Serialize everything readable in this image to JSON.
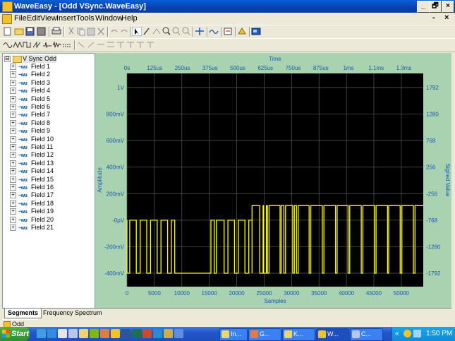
{
  "window": {
    "title": "WaveEasy - [Odd VSync.WaveEasy]",
    "min": "_",
    "max": "🗗",
    "close": "×"
  },
  "menu": {
    "items": [
      "File",
      "Edit",
      "View",
      "Insert",
      "Tools",
      "Window",
      "Help"
    ],
    "mdi_min": "-",
    "mdi_close": "×"
  },
  "tree": {
    "root": "V Sync Odd",
    "expander": "⊟",
    "sig_icon_text": "~wu",
    "items": [
      "Field 1",
      "Field 2",
      "Field 3",
      "Field 4",
      "Field 5",
      "Field 6",
      "Field 7",
      "Field 8",
      "Field 9",
      "Field 10",
      "Field 11",
      "Field 12",
      "Field 13",
      "Field 14",
      "Field 15",
      "Field 16",
      "Field 17",
      "Field 18",
      "Field 19",
      "Field 20",
      "Field 21"
    ]
  },
  "tabs": {
    "segments": "Segments",
    "frequency": "Frequency Spectrum"
  },
  "minidoc": "Odd VSy",
  "taskbar": {
    "start": "Start",
    "tasks": [
      "In...",
      "G...",
      "K...",
      "W...",
      "C..."
    ],
    "tray_arrow": "«",
    "clock": "1:50 PM"
  },
  "colors": {
    "plot_bg": "#000000",
    "panel_bg": "#a9d3b0",
    "trace": "#ffff00",
    "label": "#1a56b0"
  },
  "chart_data": {
    "type": "line",
    "top_axis_title": "Time",
    "top_ticks": [
      "0s",
      "125us",
      "250us",
      "375us",
      "500us",
      "625us",
      "750us",
      "875us",
      "1ms",
      "1.1ms",
      "1.3ms"
    ],
    "xlabel": "Samples",
    "x_ticks": [
      "0",
      "5000",
      "10000",
      "15000",
      "20000",
      "25000",
      "30000",
      "35000",
      "40000",
      "45000",
      "50000"
    ],
    "xlim": [
      0,
      54000
    ],
    "ylabel": "Amplitude",
    "y_ticks": [
      "1V",
      "800mV",
      "600mV",
      "400mV",
      "200mV",
      "-0pV",
      "-200mV",
      "-400mV"
    ],
    "ylim": [
      -400,
      1100
    ],
    "y2label": "Signed Value",
    "y2_ticks": [
      "1792",
      "1280",
      "768",
      "256",
      "-256",
      "-768",
      "-1280",
      "-1792"
    ],
    "series": [
      {
        "values_note": "",
        "segments": [
          {
            "x0": 0,
            "x1": 22800,
            "low": -400,
            "high": 0,
            "pulses": [
              [
                0,
                500
              ],
              [
                1700,
                2400
              ],
              [
                3600,
                4300
              ],
              [
                5500,
                6200
              ],
              [
                7400,
                8100
              ],
              [
                8700,
                15300
              ],
              [
                15900,
                16300
              ],
              [
                17700,
                18400
              ],
              [
                19600,
                20300
              ],
              [
                21500,
                22200
              ]
            ]
          },
          {
            "x0": 22800,
            "x1": 54000,
            "low": -400,
            "high": 100,
            "pulses": [
              [
                24200,
                24800
              ],
              [
                24900,
                25400
              ],
              [
                25600,
                25900
              ],
              [
                27900,
                28100
              ],
              [
                28600,
                28900
              ],
              [
                30200,
                30500
              ],
              [
                30900,
                31200
              ],
              [
                33200,
                33500
              ],
              [
                35600,
                35900
              ],
              [
                38000,
                38300
              ],
              [
                40300,
                40600
              ],
              [
                42700,
                43000
              ],
              [
                45100,
                45400
              ],
              [
                47500,
                47700
              ],
              [
                49800,
                50100
              ],
              [
                52200,
                52500
              ]
            ]
          }
        ]
      }
    ]
  }
}
